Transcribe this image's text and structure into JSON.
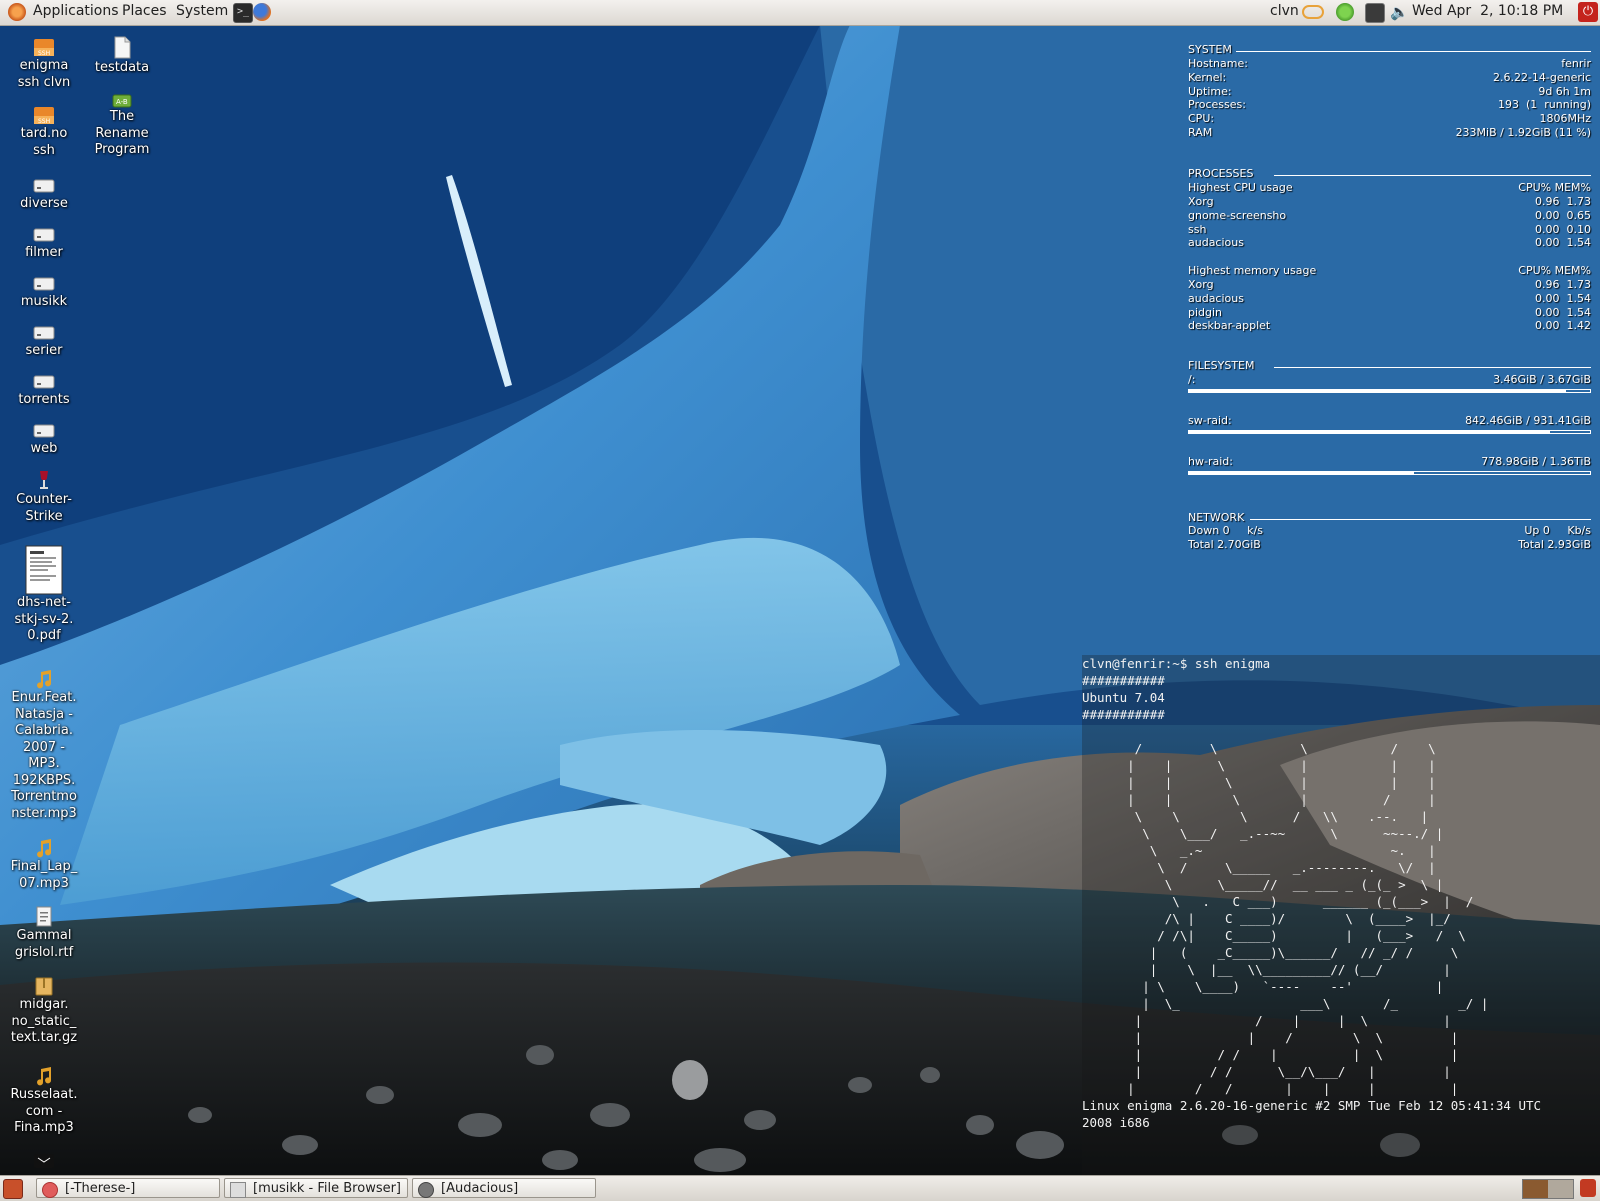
{
  "top_panel": {
    "menus": [
      "Applications",
      "Places",
      "System"
    ],
    "user": "clvn",
    "clock": "Wed Apr  2, 10:18 PM"
  },
  "desktop_icons": [
    {
      "label": "enigma\nssh clvn",
      "icon": "ssh-folder-icon"
    },
    {
      "label": "testdata",
      "icon": "file-icon"
    },
    {
      "label": "tard.no\nssh",
      "icon": "ssh-folder-icon"
    },
    {
      "label": "The\nRename\nProgram",
      "icon": "program-icon"
    },
    {
      "label": "diverse",
      "icon": "drive-icon"
    },
    {
      "label": "filmer",
      "icon": "drive-icon"
    },
    {
      "label": "musikk",
      "icon": "drive-icon"
    },
    {
      "label": "serier",
      "icon": "drive-icon"
    },
    {
      "label": "torrents",
      "icon": "drive-icon"
    },
    {
      "label": "web",
      "icon": "drive-icon"
    },
    {
      "label": "Counter-\nStrike",
      "icon": "wine-icon"
    },
    {
      "label": "dhs-net-\nstkj-sv-2.\n0.pdf",
      "icon": "pdf-thumbnail-icon"
    },
    {
      "label": "Enur.Feat.\nNatasja -\nCalabria.\n2007 -\nMP3.\n192KBPS.\nTorrentmo\nnster.mp3",
      "icon": "music-note-icon"
    },
    {
      "label": "Final_Lap_\n07.mp3",
      "icon": "music-note-icon"
    },
    {
      "label": "Gammal\ngrislol.rtf",
      "icon": "document-icon"
    },
    {
      "label": "midgar.\nno_static_\ntext.tar.gz",
      "icon": "archive-icon"
    },
    {
      "label": "Russelaat.\ncom -\nFina.mp3",
      "icon": "music-note-icon"
    }
  ],
  "conky": {
    "system": {
      "title": "SYSTEM",
      "rows": [
        {
          "label": "Hostname:",
          "value": "fenrir"
        },
        {
          "label": "Kernel:",
          "value": "2.6.22-14-generic"
        },
        {
          "label": "Uptime:",
          "value": "9d 6h 1m"
        },
        {
          "label": "Processes:",
          "value": "193  (1  running)"
        },
        {
          "label": "CPU:",
          "value": "1806MHz"
        },
        {
          "label": "RAM",
          "value": "233MiB / 1.92GiB (11 %)"
        }
      ]
    },
    "processes": {
      "title": "PROCESSES",
      "cpu_header": {
        "label": "Highest CPU usage",
        "value": "CPU% MEM%"
      },
      "cpu_rows": [
        {
          "label": "Xorg",
          "value": "0.96  1.73"
        },
        {
          "label": "gnome-screensho",
          "value": "0.00  0.65"
        },
        {
          "label": "ssh",
          "value": "0.00  0.10"
        },
        {
          "label": "audacious",
          "value": "0.00  1.54"
        }
      ],
      "mem_header": {
        "label": "Highest memory usage",
        "value": "CPU% MEM%"
      },
      "mem_rows": [
        {
          "label": "Xorg",
          "value": "0.96  1.73"
        },
        {
          "label": "audacious",
          "value": "0.00  1.54"
        },
        {
          "label": "pidgin",
          "value": "0.00  1.54"
        },
        {
          "label": "deskbar-applet",
          "value": "0.00  1.42"
        }
      ]
    },
    "filesystem": {
      "title": "FILESYSTEM",
      "mounts": [
        {
          "label": "/:",
          "value": "3.46GiB / 3.67GiB",
          "used_fraction": 0.94
        },
        {
          "label": "sw-raid:",
          "value": "842.46GiB / 931.41GiB",
          "used_fraction": 0.9
        },
        {
          "label": "hw-raid:",
          "value": "778.98GiB / 1.36TiB",
          "used_fraction": 0.56
        }
      ]
    },
    "network": {
      "title": "NETWORK",
      "down": "Down 0     k/s",
      "up": "Up 0     Kb/s",
      "total_down": "Total 2.70GiB",
      "total_up": "Total 2.93GiB"
    }
  },
  "terminal": {
    "prompt_line": "clvn@fenrir:~$ ssh enigma",
    "banner": "###########\nUbuntu 7.04\n###########",
    "ascii_art": "\n       /         \\           \\           /    \\\n      |    |      \\          |           |    |\n      |    |       \\         |           |    |\n      |    |        \\        |          /     |\n       \\    \\        \\      /   \\\\    .--.   |\n        \\    \\___/   _.--~~      \\      ~~--./ |\n         \\   _.~                         ~.   |\n          \\  /     \\_____   _.--------.   \\/  |\n           \\      \\_____//  __ ___ _ (_(_ >  \\ |\n            \\   .   C ___)      ______ (_(___>  |  /\n           /\\ |    C ____)/        \\  (____>  |_/\n          / /\\|    C_____)         |   (___>   /  \\\n         |   (    _C_____)\\______/   // _/ /     \\\n         |    \\  |__  \\\\_________// (__/        |\n        | \\    \\____)   `----    --'           |\n        |  \\_                ___\\       /_        _/ |\n       |               /    |     |  \\          |\n       |              |    /        \\  \\         |\n       |          / /    |          |  \\         |\n       |         / /      \\__/\\___/   |         |\n      |        /   /       |    |     |          |",
    "uname_line": "Linux enigma 2.6.20-16-generic #2 SMP Tue Feb 12 05:41:34 UTC\n2008 i686"
  },
  "bottom_panel": {
    "tasks": [
      {
        "label": "[-Therese-]",
        "icon": "pidgin-icon"
      },
      {
        "label": "[musikk - File Browser]",
        "icon": "file-browser-icon"
      },
      {
        "label": "[Audacious]",
        "icon": "audacious-icon"
      }
    ]
  }
}
